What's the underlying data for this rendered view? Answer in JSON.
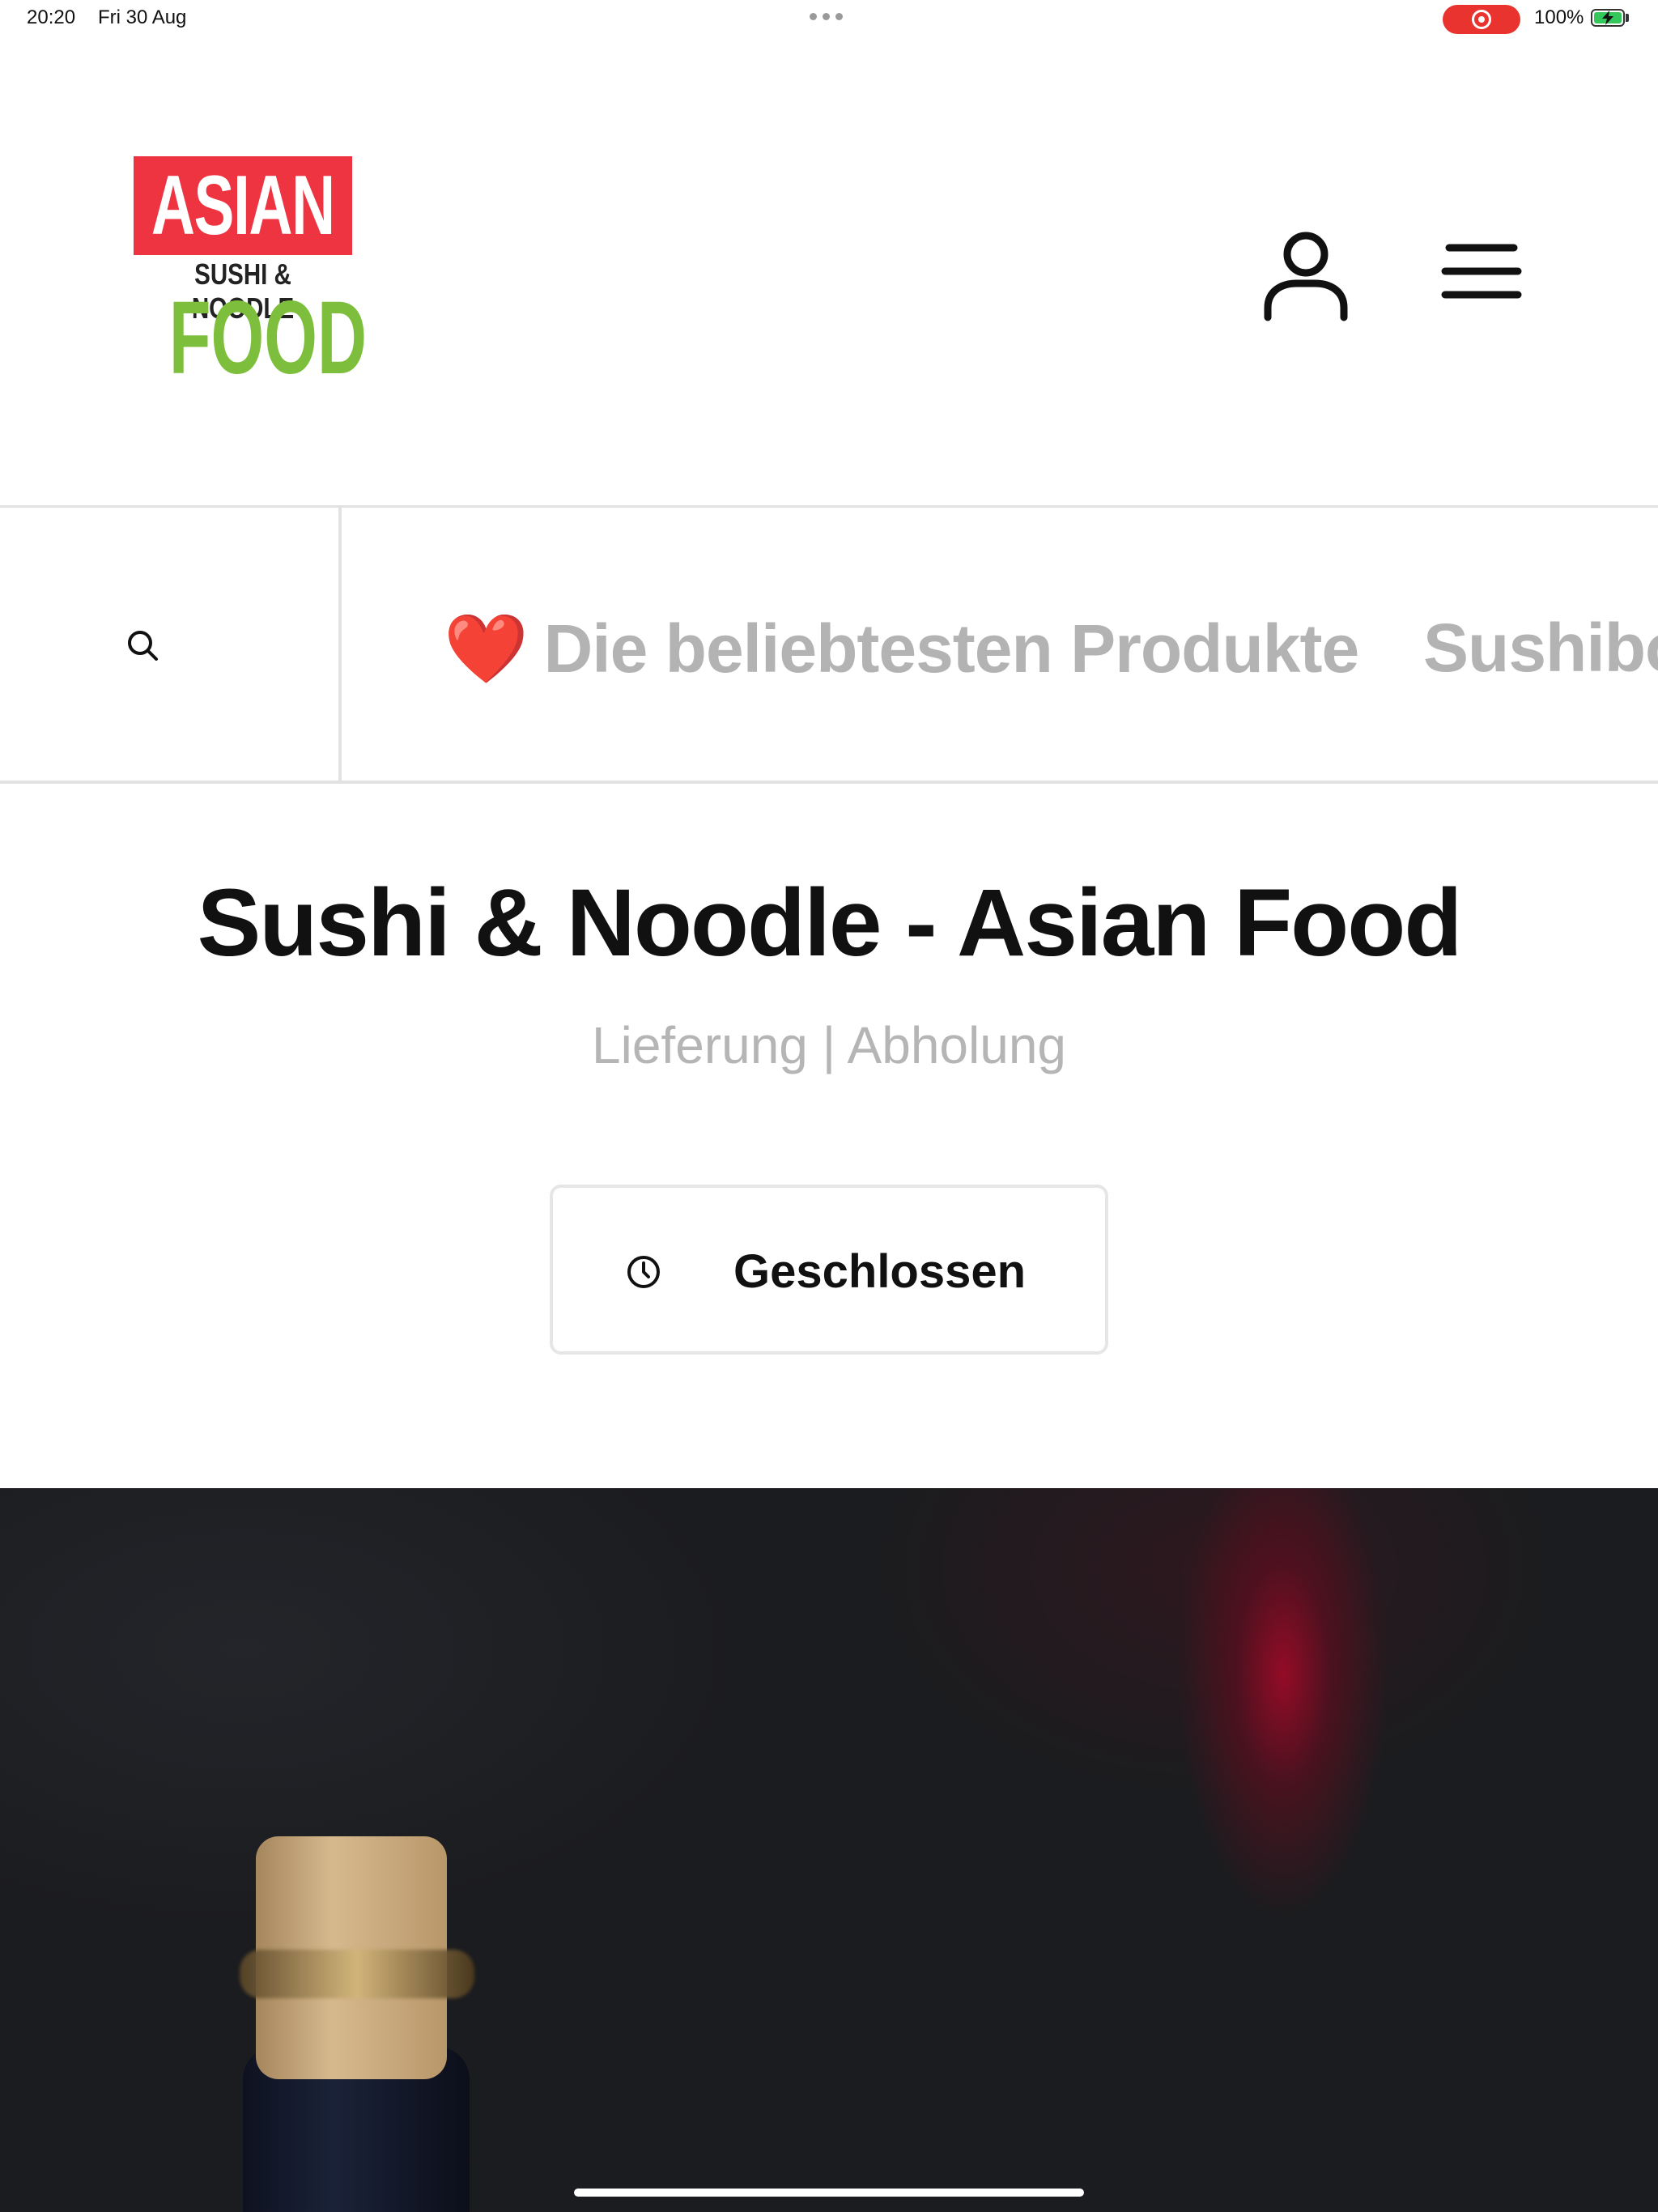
{
  "status_bar": {
    "time": "20:20",
    "date": "Fri 30 Aug",
    "battery_text": "100%",
    "battery_level": 1.0,
    "recording_color": "#e8332e",
    "battery_color": "#34c759"
  },
  "header": {
    "logo": {
      "top_text": "ASIAN",
      "middle_text": "SUSHI & NOODLE",
      "bottom_text": "FOOD",
      "top_bg_color": "#ee3441",
      "bottom_color": "#7dbf3c"
    },
    "icons": [
      "user-icon",
      "menu-icon"
    ]
  },
  "category_nav": {
    "search_icon": "search-icon",
    "items": [
      {
        "emoji": "❤️",
        "label": "Die beliebtesten Produkte"
      },
      {
        "emoji": "",
        "label": "Sushiboxen"
      }
    ]
  },
  "main": {
    "title": "Sushi & Noodle - Asian Food",
    "service_modes": "Lieferung | Abholung",
    "status_button": {
      "icon": "clock-icon",
      "label": "Geschlossen"
    }
  },
  "hero": {
    "description_icon": "hero-image"
  }
}
